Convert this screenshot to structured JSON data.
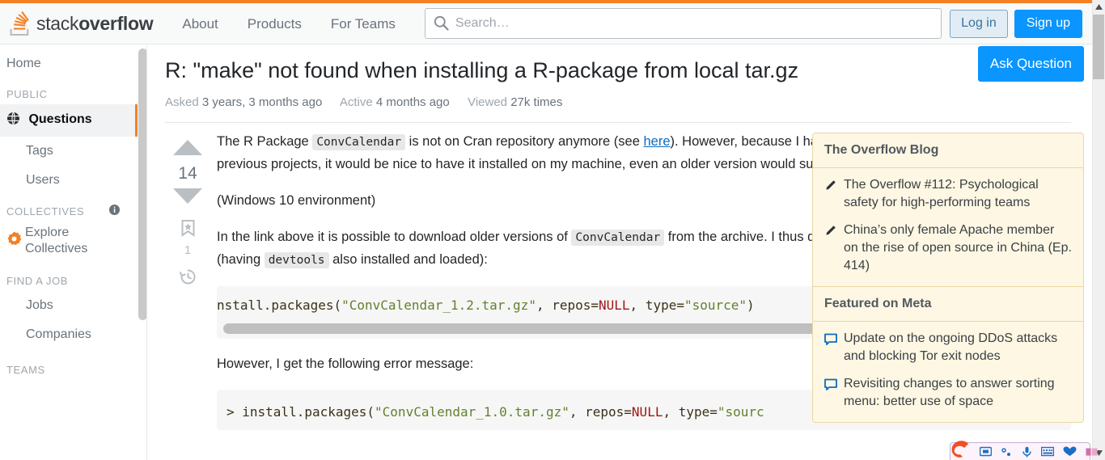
{
  "header": {
    "logo_text_light": "stack",
    "logo_text_bold": "overflow",
    "nav": [
      {
        "label": "About"
      },
      {
        "label": "Products"
      },
      {
        "label": "For Teams"
      }
    ],
    "search_placeholder": "Search…",
    "search_value": "",
    "login_label": "Log in",
    "signup_label": "Sign up"
  },
  "sidebar": {
    "home_label": "Home",
    "public_heading": "PUBLIC",
    "questions_label": "Questions",
    "tags_label": "Tags",
    "users_label": "Users",
    "collectives_heading": "COLLECTIVES",
    "explore_collectives_line1": "Explore",
    "explore_collectives_line2": "Collectives",
    "findajob_heading": "FIND A JOB",
    "jobs_label": "Jobs",
    "companies_label": "Companies",
    "teams_heading": "TEAMS"
  },
  "question": {
    "title": "R: \"make\" not found when installing a R-package from local tar.gz",
    "asked_label": "Asked",
    "asked_value": "3 years, 3 months ago",
    "active_label": "Active",
    "active_value": "4 months ago",
    "viewed_label": "Viewed",
    "viewed_value": "27k times",
    "ask_question_label": "Ask Question",
    "vote_count": "14",
    "bookmark_count": "1"
  },
  "post": {
    "p1_a": "The R Package ",
    "p1_code1": "ConvCalendar",
    "p1_b": " is not on Cran repository anymore (see ",
    "p1_link": "here",
    "p1_c": "). However, because I have intensively used this package for previous projects, it would be nice to have it installed on my machine, even an older version would suffice.",
    "p2": "(Windows 10 environment)",
    "p3_a": "In the link above it is possible to download older versions of ",
    "p3_code1": "ConvCalendar",
    "p3_b": " from the archive. I thus did it, and tried installing it by running (having ",
    "p3_code2": "devtools",
    "p3_c": " also installed and loaded):",
    "code1_plain1": "nstall.packages(",
    "code1_str1": "\"ConvCalendar_1.2.tar.gz\"",
    "code1_plain2": ", repos=",
    "code1_null": "NULL",
    "code1_plain3": ", type=",
    "code1_str2": "\"source\"",
    "code1_plain4": ")",
    "p4": "However, I get the following error message:",
    "code2_plain1": "> install.packages(",
    "code2_str1": "\"ConvCalendar_1.0.tar.gz\"",
    "code2_plain2": ", repos=",
    "code2_null": "NULL",
    "code2_plain3": ", type=",
    "code2_str2": "\"sourc"
  },
  "rail": {
    "blog_heading": "The Overflow Blog",
    "blog_items": [
      {
        "text": "The Overflow #112: Psychological safety for high-performing teams"
      },
      {
        "text": "China’s only female Apache member on the rise of open source in China (Ep. 414)"
      }
    ],
    "meta_heading": "Featured on Meta",
    "meta_items": [
      {
        "text": "Update on the ongoing DDoS attacks and blocking Tor exit nodes"
      },
      {
        "text": "Revisiting changes to answer sorting menu: better use of space"
      }
    ]
  },
  "colors": {
    "brand_orange": "#F48024",
    "link_blue": "#0a95ff",
    "rail_bg": "#fdf7e3",
    "code_string": "#63812f",
    "code_null": "#a31515"
  }
}
